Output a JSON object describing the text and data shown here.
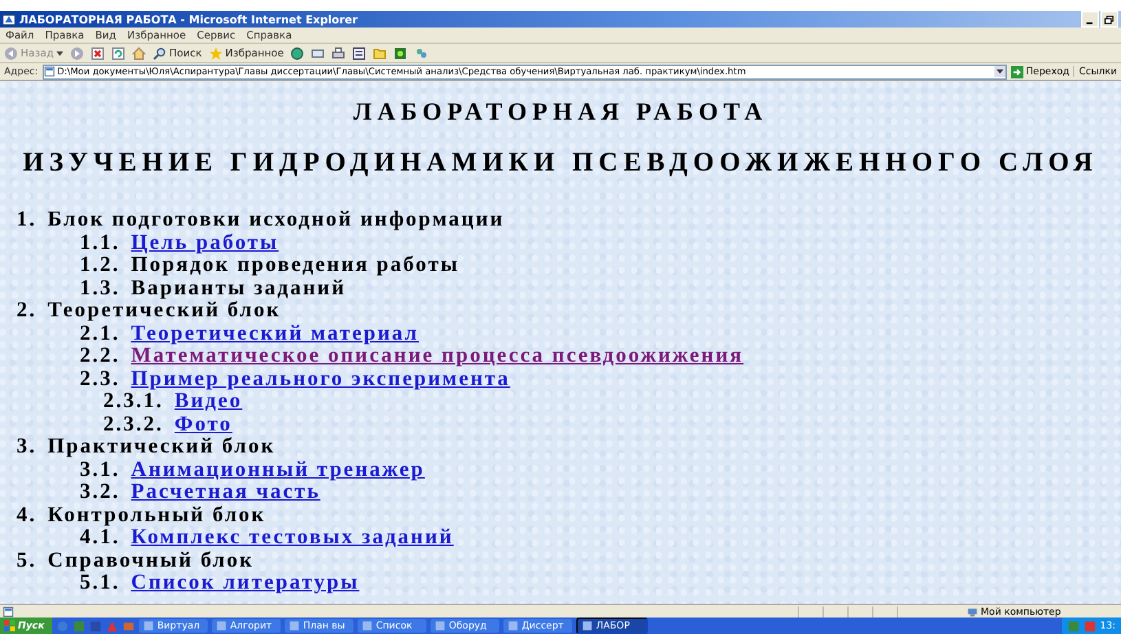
{
  "window": {
    "title": "ЛАБОРАТОРНАЯ РАБОТА - Microsoft Internet Explorer"
  },
  "menu": [
    "Файл",
    "Правка",
    "Вид",
    "Избранное",
    "Сервис",
    "Справка"
  ],
  "toolbar": {
    "back": "Назад",
    "search": "Поиск",
    "favorites": "Избранное"
  },
  "address": {
    "label": "Адрес:",
    "value": "D:\\Мои документы\\Юля\\Аспирантура\\Главы диссертации\\Главы\\Системный анализ\\Средства обучения\\Виртуальная лаб. практикум\\index.htm",
    "go": "Переход",
    "links": "Ссылки"
  },
  "page": {
    "title": "ЛАБОРАТОРНАЯ РАБОТА",
    "subtitle": "ИЗУЧЕНИЕ ГИДРОДИНАМИКИ ПСЕВДООЖИЖЕННОГО СЛОЯ",
    "outline": [
      {
        "number": "1.",
        "text": "Блок подготовки исходной информации",
        "link": false,
        "children": [
          {
            "number": "1.1.",
            "text": "Цель работы",
            "link": true,
            "visited": false
          },
          {
            "number": "1.2.",
            "text": "Порядок проведения работы",
            "link": false
          },
          {
            "number": "1.3.",
            "text": "Варианты заданий",
            "link": false
          }
        ]
      },
      {
        "number": "2.",
        "text": "Теоретический блок",
        "link": false,
        "children": [
          {
            "number": "2.1.",
            "text": "Теоретический материал",
            "link": true,
            "visited": false
          },
          {
            "number": "2.2.",
            "text": "Математическое описание процесса псевдоожижения",
            "link": true,
            "visited": true
          },
          {
            "number": "2.3.",
            "text": "Пример реального эксперимента",
            "link": true,
            "visited": false,
            "children": [
              {
                "number": "2.3.1.",
                "text": "Видео",
                "link": true,
                "visited": false
              },
              {
                "number": "2.3.2.",
                "text": "Фото",
                "link": true,
                "visited": false
              }
            ]
          }
        ]
      },
      {
        "number": "3.",
        "text": "Практический блок",
        "link": false,
        "children": [
          {
            "number": "3.1.",
            "text": "Анимационный тренажер",
            "link": true,
            "visited": false
          },
          {
            "number": "3.2.",
            "text": "Расчетная часть",
            "link": true,
            "visited": false
          }
        ]
      },
      {
        "number": "4.",
        "text": "Контрольный блок",
        "link": false,
        "children": [
          {
            "number": "4.1.",
            "text": "Комплекс тестовых заданий",
            "link": true,
            "visited": false
          }
        ]
      },
      {
        "number": "5.",
        "text": "Справочный блок",
        "link": false,
        "children": [
          {
            "number": "5.1.",
            "text": "Список литературы",
            "link": true,
            "visited": false
          }
        ]
      }
    ]
  },
  "status_bar": {
    "zone": "Мой компьютер"
  },
  "taskbar": {
    "start": "Пуск",
    "tasks": [
      {
        "label": "Виртуал",
        "selected": false
      },
      {
        "label": "Алгорит",
        "selected": false
      },
      {
        "label": "План вы",
        "selected": false
      },
      {
        "label": "Список",
        "selected": false
      },
      {
        "label": "Оборуд",
        "selected": false
      },
      {
        "label": "Диссерт",
        "selected": false
      },
      {
        "label": "ЛАБОР",
        "selected": true
      }
    ],
    "clock": "13:"
  }
}
